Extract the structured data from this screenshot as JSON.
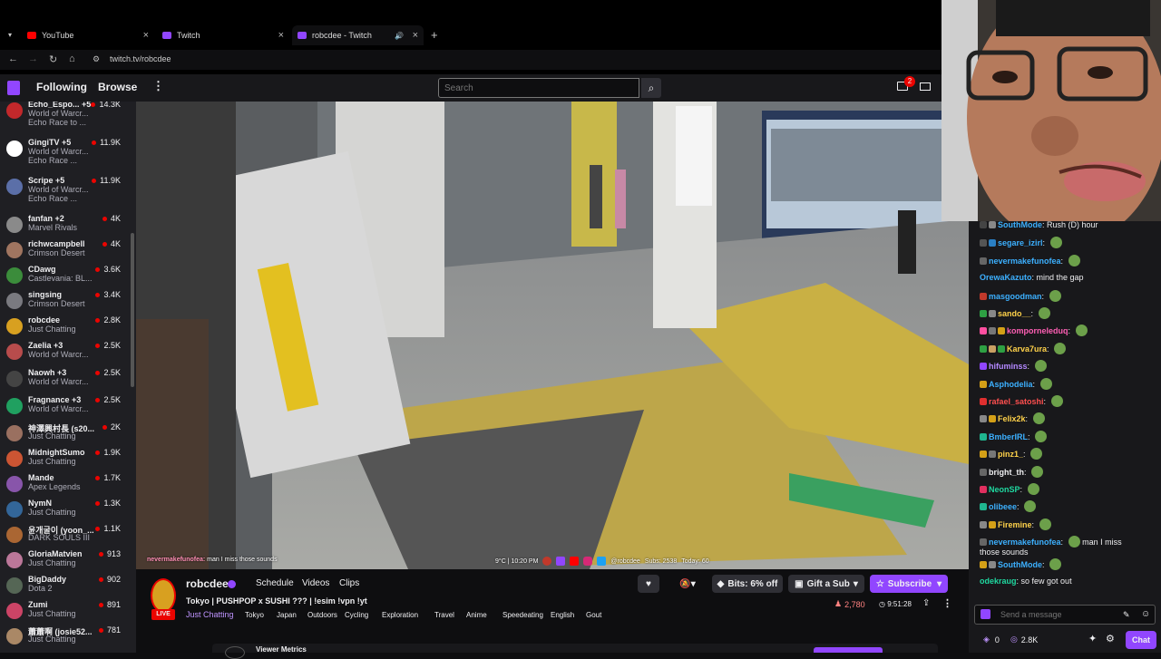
{
  "browser": {
    "tabs": [
      {
        "title": "YouTube",
        "color": "#ff0000"
      },
      {
        "title": "Twitch",
        "color": "#9146ff"
      },
      {
        "title": "robcdee - Twitch",
        "color": "#9146ff"
      }
    ],
    "new_tab": "+",
    "url": "twitch.tv/robcdee"
  },
  "nav": {
    "following": "Following",
    "browse": "Browse",
    "search_placeholder": "Search",
    "notif_count": "2"
  },
  "sidebar": {
    "channels": [
      {
        "name": "Echo_Espo... +5",
        "game": "World of Warcr...",
        "extra": "Echo Race to ...",
        "viewers": "14.3K",
        "color": "#c2282b"
      },
      {
        "name": "GingiTV +5",
        "game": "World of Warcr...",
        "extra": "Echo Race ...",
        "viewers": "11.9K",
        "color": "#ffffff"
      },
      {
        "name": "Scripe +5",
        "game": "World of Warcr...",
        "extra": "Echo Race ...",
        "viewers": "11.9K",
        "color": "#5b6fa8"
      },
      {
        "name": "fanfan +2",
        "game": "Marvel Rivals",
        "extra": "",
        "viewers": "4K",
        "color": "#8a8a8a"
      },
      {
        "name": "richwcampbell",
        "game": "Crimson Desert",
        "extra": "",
        "viewers": "4K",
        "color": "#a07560"
      },
      {
        "name": "CDawg",
        "game": "Castlevania: BL...",
        "extra": "",
        "viewers": "3.6K",
        "color": "#3b8c3b"
      },
      {
        "name": "singsing",
        "game": "Crimson Desert",
        "extra": "",
        "viewers": "3.4K",
        "color": "#7a7a80"
      },
      {
        "name": "robcdee",
        "game": "Just Chatting",
        "extra": "",
        "viewers": "2.8K",
        "color": "#d8a020"
      },
      {
        "name": "Zaelia +3",
        "game": "World of Warcr...",
        "extra": "",
        "viewers": "2.5K",
        "color": "#b84c4c"
      },
      {
        "name": "Naowh +3",
        "game": "World of Warcr...",
        "extra": "",
        "viewers": "2.5K",
        "color": "#444"
      },
      {
        "name": "Fragnance +3",
        "game": "World of Warcr...",
        "extra": "",
        "viewers": "2.5K",
        "color": "#20a060"
      },
      {
        "name": "神澤興村長 (s20...",
        "game": "Just Chatting",
        "extra": "",
        "viewers": "2K",
        "color": "#9a7060"
      },
      {
        "name": "MidnightSumo",
        "game": "Just Chatting",
        "extra": "",
        "viewers": "1.9K",
        "color": "#cc5533"
      },
      {
        "name": "Mande",
        "game": "Apex Legends",
        "extra": "",
        "viewers": "1.7K",
        "color": "#8855aa"
      },
      {
        "name": "NymN",
        "game": "Just Chatting",
        "extra": "",
        "viewers": "1.3K",
        "color": "#336699"
      },
      {
        "name": "윤개굴이 (yoon_...",
        "game": "DARK SOULS III",
        "extra": "",
        "viewers": "1.1K",
        "color": "#aa6633"
      },
      {
        "name": "GloriaMatvien",
        "game": "Just Chatting",
        "extra": "",
        "viewers": "913",
        "color": "#bb7799"
      },
      {
        "name": "BigDaddy",
        "game": "Dota 2",
        "extra": "",
        "viewers": "902",
        "color": "#556655"
      },
      {
        "name": "Zumi",
        "game": "Just Chatting",
        "extra": "",
        "viewers": "891",
        "color": "#cc4466"
      },
      {
        "name": "蕭蕭啊 (josie52...",
        "game": "Just Chatting",
        "extra": "",
        "viewers": "781",
        "color": "#aa8866"
      }
    ]
  },
  "overlay": {
    "chat_line_user": "nevermakefunofea:",
    "chat_line_text": "man I miss those sounds",
    "status_left": "9°C | 10:20 PM",
    "handle": "@robcdee",
    "subs": "Subs: 2538",
    "today": "Today: 60"
  },
  "stream": {
    "channel": "robcdee",
    "tabs": [
      "Schedule",
      "Videos",
      "Clips"
    ],
    "title": "Tokyo | PUSHPOP x SUSHI ??? | !esim !vpn !yt",
    "live_label": "LIVE",
    "category": "Just Chatting",
    "tags": [
      "Tokyo",
      "Japan",
      "Outdoors",
      "Cycling",
      "Exploration",
      "Travel",
      "Anime",
      "Speedeating",
      "English",
      "Gout"
    ],
    "bits_label": "Bits: 6% off",
    "gift_label": "Gift a Sub",
    "subscribe_label": "Subscribe",
    "viewers": "2,780",
    "uptime": "9:51:28",
    "viewer_metrics": "Viewer Metrics"
  },
  "chat": {
    "messages": [
      {
        "user": "SouthMode",
        "color": "#3cb0ff",
        "text": "Rush (D) hour",
        "badges": [
          "#444",
          "#888"
        ],
        "emote": false
      },
      {
        "user": "segare_izirl",
        "color": "#3cb0ff",
        "text": "",
        "badges": [
          "#555",
          "#2a7fc4"
        ],
        "emote": true
      },
      {
        "user": "nevermakefunofea",
        "color": "#3cb0ff",
        "text": "",
        "badges": [
          "#666"
        ],
        "emote": true
      },
      {
        "user": "OrewaKazuto",
        "color": "#3cb0ff",
        "text": "mind the gap",
        "badges": [],
        "emote": false
      },
      {
        "user": "masgoodman",
        "color": "#3cb0ff",
        "text": "",
        "badges": [
          "#c0392b"
        ],
        "emote": true
      },
      {
        "user": "sando__",
        "color": "#ffd24a",
        "text": "",
        "badges": [
          "#2ea043",
          "#888"
        ],
        "emote": true
      },
      {
        "user": "komporneleduq",
        "color": "#ff5fb5",
        "text": "",
        "badges": [
          "#ff4fa0",
          "#777",
          "#d4a017"
        ],
        "emote": true
      },
      {
        "user": "Karva7ura",
        "color": "#ffd24a",
        "text": "",
        "badges": [
          "#2ea043",
          "#c9a063",
          "#2ea043"
        ],
        "emote": true
      },
      {
        "user": "hifuminss",
        "color": "#b388ff",
        "text": "",
        "badges": [
          "#9146ff"
        ],
        "emote": true
      },
      {
        "user": "Asphodelia",
        "color": "#3cb0ff",
        "text": "",
        "badges": [
          "#d4a017"
        ],
        "emote": true
      },
      {
        "user": "rafael_satoshi",
        "color": "#ff4f4f",
        "text": "",
        "badges": [
          "#e02f2f"
        ],
        "emote": true
      },
      {
        "user": "Felix2k",
        "color": "#ffd24a",
        "text": "",
        "badges": [
          "#888",
          "#d4a017"
        ],
        "emote": true
      },
      {
        "user": "BmberIRL",
        "color": "#3cb0ff",
        "text": "",
        "badges": [
          "#1fb58f"
        ],
        "emote": true
      },
      {
        "user": "pinz1_",
        "color": "#ffd24a",
        "text": "",
        "badges": [
          "#d4a017",
          "#777"
        ],
        "emote": true
      },
      {
        "user": "bright_th",
        "color": "#efeff1",
        "text": "",
        "badges": [
          "#666"
        ],
        "emote": true
      },
      {
        "user": "NeonSP",
        "color": "#1fd8a0",
        "text": "",
        "badges": [
          "#e02f5f"
        ],
        "emote": true
      },
      {
        "user": "olibeee",
        "color": "#3cb0ff",
        "text": "",
        "badges": [
          "#1fb58f"
        ],
        "emote": true
      },
      {
        "user": "Firemine",
        "color": "#ffd24a",
        "text": "",
        "badges": [
          "#888",
          "#d4a017"
        ],
        "emote": true
      },
      {
        "user": "nevermakefunofea",
        "color": "#3cb0ff",
        "text": "man I miss",
        "badges": [
          "#666"
        ],
        "emote": true
      },
      {
        "user": "",
        "color": "#efeff1",
        "text": "those sounds",
        "badges": [],
        "emote": false
      },
      {
        "user": "SouthMode",
        "color": "#3cb0ff",
        "text": "",
        "badges": [
          "#d4a017",
          "#888"
        ],
        "emote": true
      },
      {
        "user": "odekraug",
        "color": "#1fd8a0",
        "text": "so few got out",
        "badges": [],
        "emote": false
      }
    ],
    "input_placeholder": "Send a message",
    "points": "0",
    "points_count": "2.8K",
    "chat_button": "Chat"
  }
}
